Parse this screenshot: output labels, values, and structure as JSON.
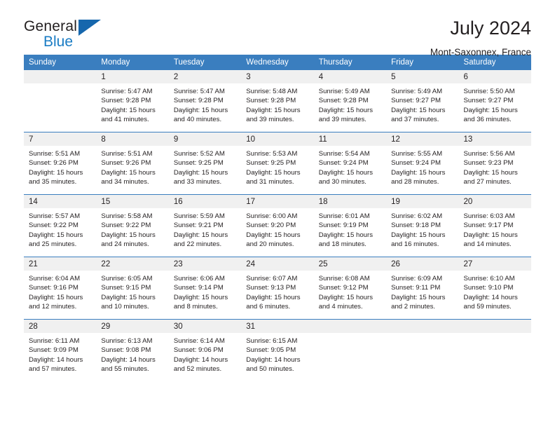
{
  "brand": {
    "word_one": "General",
    "word_two": "Blue",
    "flag_icon": "triangle-flag-icon"
  },
  "header": {
    "title": "July 2024",
    "location": "Mont-Saxonnex, France"
  },
  "colors": {
    "header_blue": "#3a7ebf",
    "brand_blue": "#1a7cc4",
    "daynum_bg": "#f0f0f0",
    "text": "#231f20"
  },
  "calendar": {
    "weekday_headers": [
      "Sunday",
      "Monday",
      "Tuesday",
      "Wednesday",
      "Thursday",
      "Friday",
      "Saturday"
    ],
    "weeks": [
      [
        {
          "day": "",
          "lines": []
        },
        {
          "day": "1",
          "lines": [
            "Sunrise: 5:47 AM",
            "Sunset: 9:28 PM",
            "Daylight: 15 hours",
            "and 41 minutes."
          ]
        },
        {
          "day": "2",
          "lines": [
            "Sunrise: 5:47 AM",
            "Sunset: 9:28 PM",
            "Daylight: 15 hours",
            "and 40 minutes."
          ]
        },
        {
          "day": "3",
          "lines": [
            "Sunrise: 5:48 AM",
            "Sunset: 9:28 PM",
            "Daylight: 15 hours",
            "and 39 minutes."
          ]
        },
        {
          "day": "4",
          "lines": [
            "Sunrise: 5:49 AM",
            "Sunset: 9:28 PM",
            "Daylight: 15 hours",
            "and 39 minutes."
          ]
        },
        {
          "day": "5",
          "lines": [
            "Sunrise: 5:49 AM",
            "Sunset: 9:27 PM",
            "Daylight: 15 hours",
            "and 37 minutes."
          ]
        },
        {
          "day": "6",
          "lines": [
            "Sunrise: 5:50 AM",
            "Sunset: 9:27 PM",
            "Daylight: 15 hours",
            "and 36 minutes."
          ]
        }
      ],
      [
        {
          "day": "7",
          "lines": [
            "Sunrise: 5:51 AM",
            "Sunset: 9:26 PM",
            "Daylight: 15 hours",
            "and 35 minutes."
          ]
        },
        {
          "day": "8",
          "lines": [
            "Sunrise: 5:51 AM",
            "Sunset: 9:26 PM",
            "Daylight: 15 hours",
            "and 34 minutes."
          ]
        },
        {
          "day": "9",
          "lines": [
            "Sunrise: 5:52 AM",
            "Sunset: 9:25 PM",
            "Daylight: 15 hours",
            "and 33 minutes."
          ]
        },
        {
          "day": "10",
          "lines": [
            "Sunrise: 5:53 AM",
            "Sunset: 9:25 PM",
            "Daylight: 15 hours",
            "and 31 minutes."
          ]
        },
        {
          "day": "11",
          "lines": [
            "Sunrise: 5:54 AM",
            "Sunset: 9:24 PM",
            "Daylight: 15 hours",
            "and 30 minutes."
          ]
        },
        {
          "day": "12",
          "lines": [
            "Sunrise: 5:55 AM",
            "Sunset: 9:24 PM",
            "Daylight: 15 hours",
            "and 28 minutes."
          ]
        },
        {
          "day": "13",
          "lines": [
            "Sunrise: 5:56 AM",
            "Sunset: 9:23 PM",
            "Daylight: 15 hours",
            "and 27 minutes."
          ]
        }
      ],
      [
        {
          "day": "14",
          "lines": [
            "Sunrise: 5:57 AM",
            "Sunset: 9:22 PM",
            "Daylight: 15 hours",
            "and 25 minutes."
          ]
        },
        {
          "day": "15",
          "lines": [
            "Sunrise: 5:58 AM",
            "Sunset: 9:22 PM",
            "Daylight: 15 hours",
            "and 24 minutes."
          ]
        },
        {
          "day": "16",
          "lines": [
            "Sunrise: 5:59 AM",
            "Sunset: 9:21 PM",
            "Daylight: 15 hours",
            "and 22 minutes."
          ]
        },
        {
          "day": "17",
          "lines": [
            "Sunrise: 6:00 AM",
            "Sunset: 9:20 PM",
            "Daylight: 15 hours",
            "and 20 minutes."
          ]
        },
        {
          "day": "18",
          "lines": [
            "Sunrise: 6:01 AM",
            "Sunset: 9:19 PM",
            "Daylight: 15 hours",
            "and 18 minutes."
          ]
        },
        {
          "day": "19",
          "lines": [
            "Sunrise: 6:02 AM",
            "Sunset: 9:18 PM",
            "Daylight: 15 hours",
            "and 16 minutes."
          ]
        },
        {
          "day": "20",
          "lines": [
            "Sunrise: 6:03 AM",
            "Sunset: 9:17 PM",
            "Daylight: 15 hours",
            "and 14 minutes."
          ]
        }
      ],
      [
        {
          "day": "21",
          "lines": [
            "Sunrise: 6:04 AM",
            "Sunset: 9:16 PM",
            "Daylight: 15 hours",
            "and 12 minutes."
          ]
        },
        {
          "day": "22",
          "lines": [
            "Sunrise: 6:05 AM",
            "Sunset: 9:15 PM",
            "Daylight: 15 hours",
            "and 10 minutes."
          ]
        },
        {
          "day": "23",
          "lines": [
            "Sunrise: 6:06 AM",
            "Sunset: 9:14 PM",
            "Daylight: 15 hours",
            "and 8 minutes."
          ]
        },
        {
          "day": "24",
          "lines": [
            "Sunrise: 6:07 AM",
            "Sunset: 9:13 PM",
            "Daylight: 15 hours",
            "and 6 minutes."
          ]
        },
        {
          "day": "25",
          "lines": [
            "Sunrise: 6:08 AM",
            "Sunset: 9:12 PM",
            "Daylight: 15 hours",
            "and 4 minutes."
          ]
        },
        {
          "day": "26",
          "lines": [
            "Sunrise: 6:09 AM",
            "Sunset: 9:11 PM",
            "Daylight: 15 hours",
            "and 2 minutes."
          ]
        },
        {
          "day": "27",
          "lines": [
            "Sunrise: 6:10 AM",
            "Sunset: 9:10 PM",
            "Daylight: 14 hours",
            "and 59 minutes."
          ]
        }
      ],
      [
        {
          "day": "28",
          "lines": [
            "Sunrise: 6:11 AM",
            "Sunset: 9:09 PM",
            "Daylight: 14 hours",
            "and 57 minutes."
          ]
        },
        {
          "day": "29",
          "lines": [
            "Sunrise: 6:13 AM",
            "Sunset: 9:08 PM",
            "Daylight: 14 hours",
            "and 55 minutes."
          ]
        },
        {
          "day": "30",
          "lines": [
            "Sunrise: 6:14 AM",
            "Sunset: 9:06 PM",
            "Daylight: 14 hours",
            "and 52 minutes."
          ]
        },
        {
          "day": "31",
          "lines": [
            "Sunrise: 6:15 AM",
            "Sunset: 9:05 PM",
            "Daylight: 14 hours",
            "and 50 minutes."
          ]
        },
        {
          "day": "",
          "lines": []
        },
        {
          "day": "",
          "lines": []
        },
        {
          "day": "",
          "lines": []
        }
      ]
    ]
  }
}
